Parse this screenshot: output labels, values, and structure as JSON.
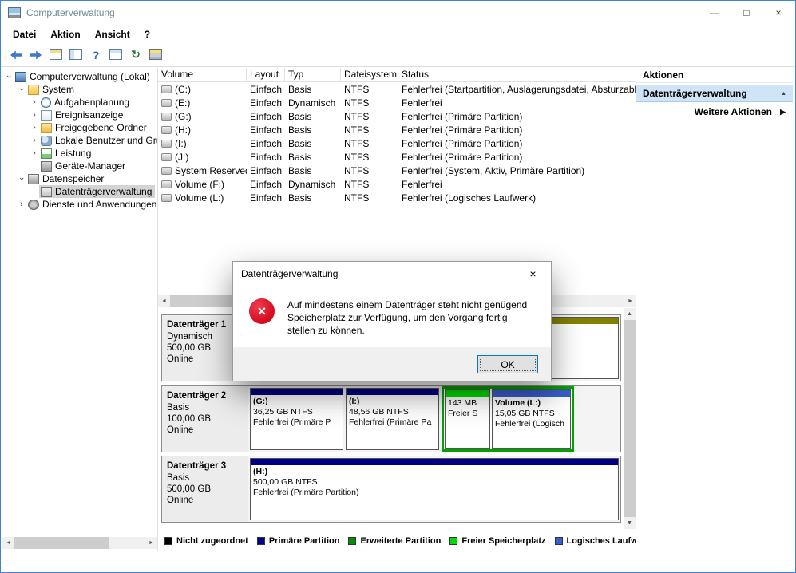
{
  "window": {
    "title": "Computerverwaltung",
    "minimize_glyph": "—",
    "maximize_glyph": "□",
    "close_glyph": "×"
  },
  "menubar": {
    "items": [
      "Datei",
      "Aktion",
      "Ansicht",
      "?"
    ]
  },
  "toolbar": {
    "icons": [
      "back-icon",
      "forward-icon",
      "export-list-icon",
      "show-console-tree-icon",
      "help-icon",
      "properties-icon",
      "refresh-icon",
      "action-pane-icon"
    ],
    "help_glyph": "?",
    "refresh_glyph": "↻"
  },
  "tree": {
    "items": [
      {
        "label": "Computerverwaltung (Lokal)"
      },
      {
        "label": "System"
      },
      {
        "label": "Aufgabenplanung"
      },
      {
        "label": "Ereignisanzeige"
      },
      {
        "label": "Freigegebene Ordner"
      },
      {
        "label": "Lokale Benutzer und Gru"
      },
      {
        "label": "Leistung"
      },
      {
        "label": "Geräte-Manager"
      },
      {
        "label": "Datenspeicher"
      },
      {
        "label": "Datenträgerverwaltung"
      },
      {
        "label": "Dienste und Anwendungen"
      }
    ]
  },
  "volumes": {
    "columns": [
      "Volume",
      "Layout",
      "Typ",
      "Dateisystem",
      "Status"
    ],
    "rows": [
      {
        "volume": "(C:)",
        "layout": "Einfach",
        "typ": "Basis",
        "fs": "NTFS",
        "status": "Fehlerfrei (Startpartition, Auslagerungsdatei, Absturzabb"
      },
      {
        "volume": "(E:)",
        "layout": "Einfach",
        "typ": "Dynamisch",
        "fs": "NTFS",
        "status": "Fehlerfrei"
      },
      {
        "volume": "(G:)",
        "layout": "Einfach",
        "typ": "Basis",
        "fs": "NTFS",
        "status": "Fehlerfrei (Primäre Partition)"
      },
      {
        "volume": "(H:)",
        "layout": "Einfach",
        "typ": "Basis",
        "fs": "NTFS",
        "status": "Fehlerfrei (Primäre Partition)"
      },
      {
        "volume": "(I:)",
        "layout": "Einfach",
        "typ": "Basis",
        "fs": "NTFS",
        "status": "Fehlerfrei (Primäre Partition)"
      },
      {
        "volume": "(J:)",
        "layout": "Einfach",
        "typ": "Basis",
        "fs": "NTFS",
        "status": "Fehlerfrei (Primäre Partition)"
      },
      {
        "volume": "System Reserved",
        "layout": "Einfach",
        "typ": "Basis",
        "fs": "NTFS",
        "status": "Fehlerfrei (System, Aktiv, Primäre Partition)"
      },
      {
        "volume": "Volume (F:)",
        "layout": "Einfach",
        "typ": "Dynamisch",
        "fs": "NTFS",
        "status": "Fehlerfrei"
      },
      {
        "volume": "Volume (L:)",
        "layout": "Einfach",
        "typ": "Basis",
        "fs": "NTFS",
        "status": "Fehlerfrei (Logisches Laufwerk)"
      }
    ]
  },
  "disks": {
    "disk1": {
      "name": "Datenträger 1",
      "kind": "Dynamisch",
      "size": "500,00 GB",
      "state": "Online"
    },
    "disk2": {
      "name": "Datenträger 2",
      "kind": "Basis",
      "size": "100,00 GB",
      "state": "Online",
      "p1": {
        "title": "(G:)",
        "size": "36,25 GB NTFS",
        "status": "Fehlerfrei (Primäre P"
      },
      "p2": {
        "title": "(I:)",
        "size": "48,56 GB NTFS",
        "status": "Fehlerfrei (Primäre Pa"
      },
      "free": {
        "title": "143 MB",
        "status": "Freier S"
      },
      "p3": {
        "title": "Volume (L:)",
        "size": "15,05 GB NTFS",
        "status": "Fehlerfrei (Logisch"
      }
    },
    "disk3": {
      "name": "Datenträger 3",
      "kind": "Basis",
      "size": "500,00 GB",
      "state": "Online",
      "p1": {
        "title": "(H:)",
        "size": "500,00 GB NTFS",
        "status": "Fehlerfrei (Primäre Partition)"
      }
    }
  },
  "legend": {
    "items": [
      {
        "label": "Nicht zugeordnet",
        "color": "#000000"
      },
      {
        "label": "Primäre Partition",
        "color": "#000082"
      },
      {
        "label": "Erweiterte Partition",
        "color": "#009100"
      },
      {
        "label": "Freier Speicherplatz",
        "color": "#00dc00"
      },
      {
        "label": "Logisches Laufwerk",
        "color": "#3a5fcd"
      }
    ]
  },
  "actions": {
    "header": "Aktionen",
    "section": "Datenträgerverwaltung",
    "more": "Weitere Aktionen"
  },
  "dialog": {
    "title": "Datenträgerverwaltung",
    "message": "Auf mindestens einem Datenträger steht nicht genügend Speicherplatz zur Verfügung, um den Vorgang fertig stellen zu können.",
    "ok_label": "OK"
  },
  "colors": {
    "primary_partition": "#000082",
    "extended_border": "#00a400",
    "free_space": "#00dc00",
    "logical_drive": "#3a5fcd",
    "dynamic_volume": "#828200",
    "accent": "#3f85d6"
  }
}
